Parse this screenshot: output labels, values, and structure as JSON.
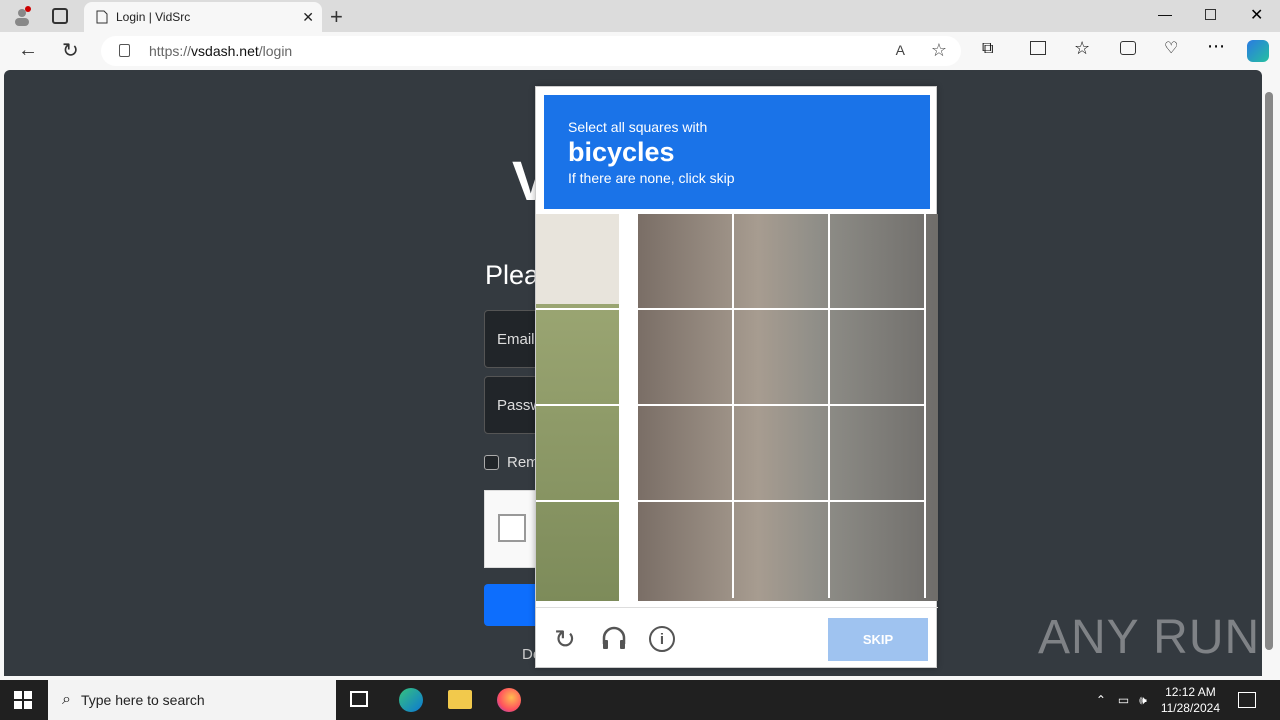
{
  "browser": {
    "tab_title": "Login | VidSrc",
    "url_prefix": "https://",
    "url_host": "vsdash.net",
    "url_path": "/login"
  },
  "page": {
    "logo_fragment": "V",
    "heading_fragment": "Plea",
    "email_placeholder": "Email",
    "password_placeholder": "Passw",
    "remember_fragment": "Rem",
    "footer_fragment": "De"
  },
  "captcha": {
    "line1": "Select all squares with",
    "target": "bicycles",
    "line3": "If there are none, click skip",
    "skip_label": "SKIP"
  },
  "watermark": "ANY RUN",
  "taskbar": {
    "search_placeholder": "Type here to search",
    "time": "12:12 AM",
    "date": "11/28/2024"
  }
}
